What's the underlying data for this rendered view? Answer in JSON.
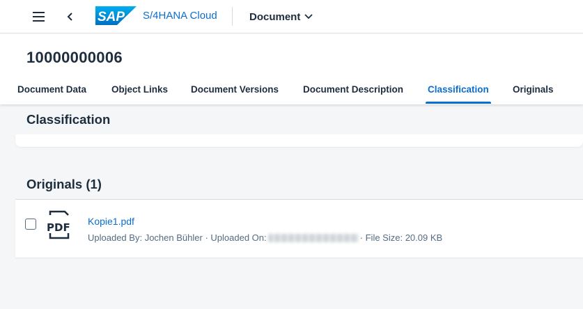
{
  "shell": {
    "logo_text": "SAP",
    "product": "S/4HANA Cloud",
    "app_title": "Document",
    "icons": [
      "menu-icon",
      "back-icon",
      "chevron-down-icon"
    ],
    "brand_color": "#0a6ed1"
  },
  "header": {
    "title": "10000000006",
    "tabs": [
      {
        "label": "Document Data",
        "active": false
      },
      {
        "label": "Object Links",
        "active": false
      },
      {
        "label": "Document Versions",
        "active": false
      },
      {
        "label": "Document Description",
        "active": false
      },
      {
        "label": "Classification",
        "active": true
      },
      {
        "label": "Originals",
        "active": false
      }
    ]
  },
  "classification": {
    "title": "Classification"
  },
  "originals": {
    "title": "Originals (1)",
    "items": [
      {
        "file_name": "Kopie1.pdf",
        "icon": "pdf-icon",
        "uploaded_by_label": "Uploaded By:",
        "uploaded_by": "Jochen Bühler",
        "uploaded_on_label": "Uploaded On:",
        "file_size_label": "File Size:",
        "file_size": "20.09 KB",
        "separator": "·"
      }
    ]
  }
}
